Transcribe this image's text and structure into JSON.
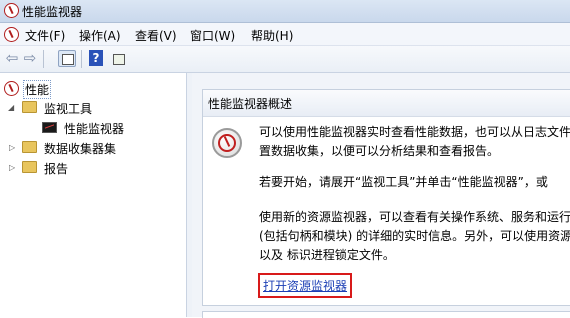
{
  "window": {
    "title": "性能监视器"
  },
  "menu": {
    "items": [
      "文件(F)",
      "操作(A)",
      "查看(V)",
      "窗口(W)",
      "帮助(H)"
    ]
  },
  "toolbar": {
    "buttons": [
      "back-arrow-icon",
      "forward-arrow-icon",
      "show-hide-tree-icon",
      "help-icon",
      "properties-icon"
    ]
  },
  "tree": {
    "root": "性能",
    "monitoring_tools": "监视工具",
    "performance_monitor": "性能监视器",
    "data_collector_sets": "数据收集器集",
    "reports": "报告"
  },
  "overview": {
    "title": "性能监视器概述",
    "p1_line1": "可以使用性能监视器实时查看性能数据，也可以从日志文件",
    "p1_line2": "置数据收集，以便可以分析结果和查看报告。",
    "p2_line1": "若要开始，请展开“监视工具”并单击“性能监视器”，或",
    "p3_line1": "使用新的资源监视器，可以查看有关操作系统、服务和运行",
    "p3_line2": "(包括句柄和模块) 的详细的实时信息。另外，可以使用资源",
    "p3_line3": "以及 标识进程锁定文件。",
    "link": "打开资源监视器"
  },
  "colors": {
    "highlight_border": "#d81a1a",
    "link": "#1c3fb5"
  }
}
